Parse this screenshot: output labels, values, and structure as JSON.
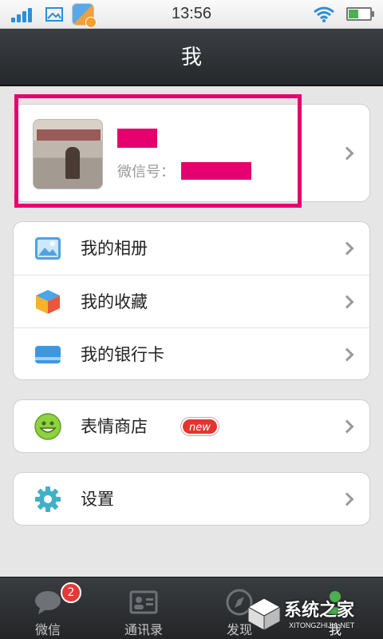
{
  "status_bar": {
    "time": "13:56",
    "icons": [
      "signal-icon",
      "picture-icon",
      "app-icon",
      "wifi-icon",
      "battery-icon"
    ]
  },
  "header": {
    "title": "我"
  },
  "profile": {
    "name": "",
    "id_label": "微信号：",
    "id_value": "",
    "highlight_color": "#e5006f"
  },
  "menu": {
    "group1": [
      {
        "label": "我的相册",
        "icon": "album-icon"
      },
      {
        "label": "我的收藏",
        "icon": "favorites-cube-icon"
      },
      {
        "label": "我的银行卡",
        "icon": "bank-card-icon"
      }
    ],
    "group2": [
      {
        "label": "表情商店",
        "icon": "smiley-icon",
        "badge": "new"
      }
    ],
    "group3": [
      {
        "label": "设置",
        "icon": "gear-icon"
      }
    ]
  },
  "tabbar": {
    "tabs": [
      {
        "label": "微信",
        "icon": "chat-bubble-icon",
        "badge": "2"
      },
      {
        "label": "通讯录",
        "icon": "contacts-card-icon"
      },
      {
        "label": "发现",
        "icon": "compass-icon"
      },
      {
        "label": "我",
        "icon": "person-icon",
        "active": true
      }
    ]
  },
  "watermark": {
    "text": "系统之家",
    "sub": "XITONGZHIJIA.NET"
  },
  "colors": {
    "accent": "#e5006f",
    "title_bar": "#2b2e31",
    "badge_red": "#e53935"
  }
}
